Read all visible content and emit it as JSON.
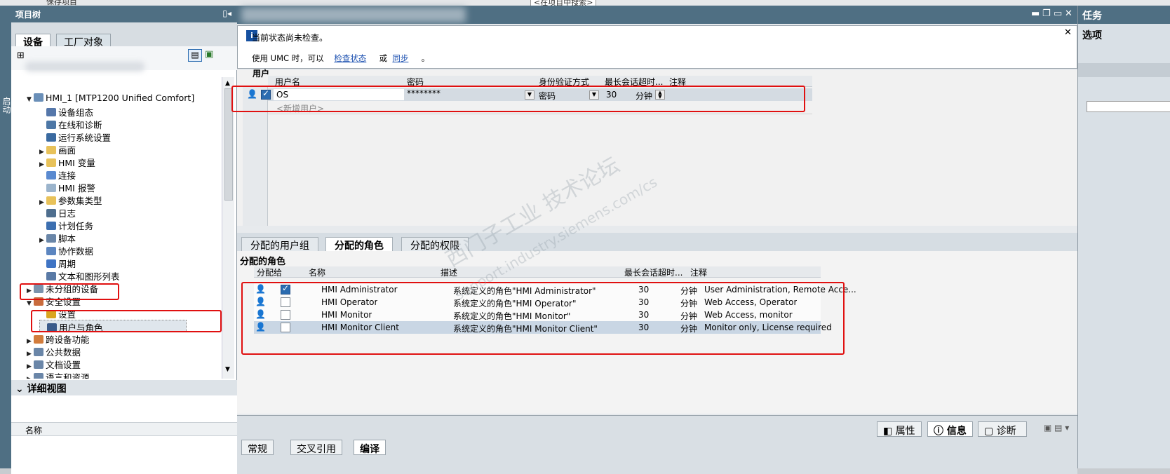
{
  "toolbar": {
    "save_label": "保存项目",
    "search_placeholder": "<在项目中搜索>"
  },
  "left": {
    "title": "项目树",
    "side_tab": "启动",
    "tabs": [
      "设备",
      "工厂对象"
    ],
    "tree": [
      {
        "label": "HMI_1 [MTP1200 Unified Comfort]",
        "indent": 0,
        "arrow": "▼",
        "icon": "hmi-device-icon",
        "color": "#6a8fb8"
      },
      {
        "label": "设备组态",
        "indent": 1,
        "arrow": "",
        "icon": "device-config-icon",
        "color": "#5577aa"
      },
      {
        "label": "在线和诊断",
        "indent": 1,
        "arrow": "",
        "icon": "online-diagnostics-icon",
        "color": "#4d77a6"
      },
      {
        "label": "运行系统设置",
        "indent": 1,
        "arrow": "",
        "icon": "runtime-settings-icon",
        "color": "#3a6aa0"
      },
      {
        "label": "画面",
        "indent": 1,
        "arrow": "▶",
        "icon": "screens-folder-icon",
        "color": "#e8c25a"
      },
      {
        "label": "HMI 变量",
        "indent": 1,
        "arrow": "▶",
        "icon": "hmi-tags-icon",
        "color": "#e8c25a"
      },
      {
        "label": "连接",
        "indent": 1,
        "arrow": "",
        "icon": "connections-icon",
        "color": "#5a8ad0"
      },
      {
        "label": "HMI 报警",
        "indent": 1,
        "arrow": "",
        "icon": "hmi-alarms-icon",
        "color": "#9bb4cc"
      },
      {
        "label": "参数集类型",
        "indent": 1,
        "arrow": "▶",
        "icon": "parameter-folder-icon",
        "color": "#e8c25a"
      },
      {
        "label": "日志",
        "indent": 1,
        "arrow": "",
        "icon": "logs-icon",
        "color": "#4e6e8e"
      },
      {
        "label": "计划任务",
        "indent": 1,
        "arrow": "",
        "icon": "scheduled-tasks-icon",
        "color": "#3c6fb0"
      },
      {
        "label": "脚本",
        "indent": 1,
        "arrow": "▶",
        "icon": "scripts-icon",
        "color": "#6a86a8"
      },
      {
        "label": "协作数据",
        "indent": 1,
        "arrow": "",
        "icon": "collaboration-icon",
        "color": "#5c86c0"
      },
      {
        "label": "周期",
        "indent": 1,
        "arrow": "",
        "icon": "cycles-icon",
        "color": "#3f74c4"
      },
      {
        "label": "文本和图形列表",
        "indent": 1,
        "arrow": "",
        "icon": "text-graphic-lists-icon",
        "color": "#5a7aa6"
      },
      {
        "label": "未分组的设备",
        "indent": 0,
        "arrow": "▶",
        "icon": "ungrouped-devices-icon",
        "color": "#7b93ad"
      },
      {
        "label": "安全设置",
        "indent": 0,
        "arrow": "▼",
        "icon": "security-settings-icon",
        "color": "#c96b3c"
      },
      {
        "label": "设置",
        "indent": 1,
        "arrow": "",
        "icon": "settings-key-icon",
        "color": "#d9a520"
      },
      {
        "label": "用户与角色",
        "indent": 1,
        "arrow": "",
        "icon": "users-roles-icon",
        "color": "#3a5b8a"
      },
      {
        "label": "跨设备功能",
        "indent": 0,
        "arrow": "▶",
        "icon": "cross-device-icon",
        "color": "#d27c3c"
      },
      {
        "label": "公共数据",
        "indent": 0,
        "arrow": "▶",
        "icon": "common-data-icon",
        "color": "#6a86a8"
      },
      {
        "label": "文档设置",
        "indent": 0,
        "arrow": "▶",
        "icon": "document-settings-icon",
        "color": "#6a86a8"
      },
      {
        "label": "语言和资源",
        "indent": 0,
        "arrow": "▶",
        "icon": "languages-icon",
        "color": "#6a86a8"
      }
    ],
    "detail_title": "详细视图",
    "detail_col": "名称"
  },
  "info": {
    "line1": "当前状态尚未检查。",
    "line2_a": "使用 UMC 时，可以",
    "link1": "检查状态",
    "line2_b": "或",
    "link2": "同步",
    "line2_c": "。"
  },
  "users": {
    "section": "用户",
    "headers": [
      "用户名",
      "密码",
      "身份验证方式",
      "最长会话超时...",
      "注释"
    ],
    "row": {
      "name": "OS",
      "password": "********",
      "auth": "密码",
      "timeout": "30",
      "unit": "分钟",
      "checked": true
    },
    "new_row": "<新增用户>"
  },
  "role_tabs": [
    "分配的用户组",
    "分配的角色",
    "分配的权限"
  ],
  "roles": {
    "title": "分配的角色",
    "headers": [
      "分配给",
      "名称",
      "描述",
      "最长会话超时...",
      "注释"
    ],
    "rows": [
      {
        "checked": true,
        "name": "HMI Administrator",
        "desc": "系统定义的角色\"HMI Administrator\"",
        "timeout": "30",
        "unit": "分钟",
        "comment": "User Administration, Remote Acce..."
      },
      {
        "checked": false,
        "name": "HMI Operator",
        "desc": "系统定义的角色\"HMI Operator\"",
        "timeout": "30",
        "unit": "分钟",
        "comment": "Web Access, Operator"
      },
      {
        "checked": false,
        "name": "HMI Monitor",
        "desc": "系统定义的角色\"HMI Monitor\"",
        "timeout": "30",
        "unit": "分钟",
        "comment": "Web Access, monitor"
      },
      {
        "checked": false,
        "name": "HMI Monitor Client",
        "desc": "系统定义的角色\"HMI Monitor Client\"",
        "timeout": "30",
        "unit": "分钟",
        "comment": "Monitor only, License required"
      }
    ]
  },
  "inspector": [
    "属性",
    "信息",
    "诊断"
  ],
  "bottom_tabs": [
    "常规",
    "交叉引用",
    "编译"
  ],
  "right": {
    "title": "任务",
    "sub": "选项"
  },
  "watermark": {
    "cn": "西门子工业 技术论坛",
    "url": "support.industry.siemens.com/cs"
  }
}
